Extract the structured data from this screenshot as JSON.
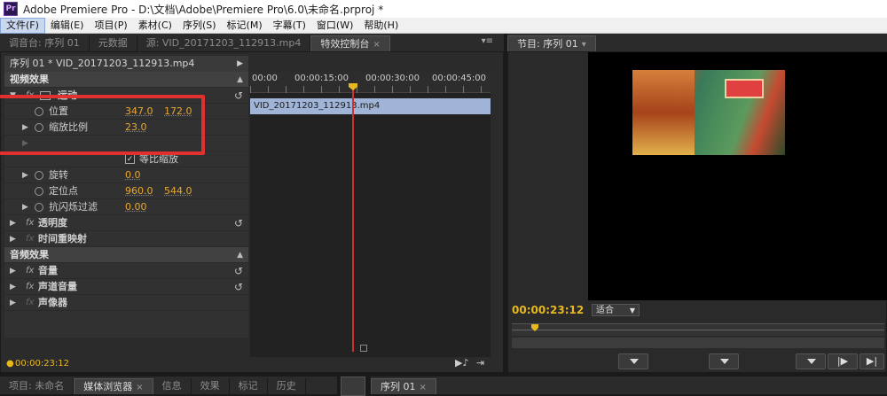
{
  "window": {
    "logo": "Pr",
    "title": "Adobe Premiere Pro - D:\\文档\\Adobe\\Premiere Pro\\6.0\\未命名.prproj *"
  },
  "menu": [
    "文件(F)",
    "编辑(E)",
    "项目(P)",
    "素材(C)",
    "序列(S)",
    "标记(M)",
    "字幕(T)",
    "窗口(W)",
    "帮助(H)"
  ],
  "left_tabs": [
    "调音台: 序列 01",
    "元数据",
    "源: VID_20171203_112913.mp4",
    "特效控制台"
  ],
  "program_tab": "节目: 序列 01",
  "effect_controls": {
    "clip_header": "序列 01 * VID_20171203_112913.mp4",
    "video_effects": "视频效果",
    "motion": "运动",
    "position_label": "位置",
    "position_x": "347.0",
    "position_y": "172.0",
    "scale_label": "缩放比例",
    "scale_value": "23.0",
    "uniform_scale": "等比缩放",
    "rotation_label": "旋转",
    "rotation_value": "0.0",
    "anchor_label": "定位点",
    "anchor_x": "960.0",
    "anchor_y": "544.0",
    "flicker_label": "抗闪烁过滤",
    "flicker_value": "0.00",
    "opacity": "透明度",
    "time_remap": "时间重映射",
    "audio_effects": "音频效果",
    "volume": "音量",
    "channel_volume": "声道音量",
    "panner": "声像器",
    "timecode": "00:00:23:12"
  },
  "timeline": {
    "ruler": [
      "00:00",
      "00:00:15:00",
      "00:00:30:00",
      "00:00:45:00"
    ],
    "clip": "VID_20171203_112913.mp4"
  },
  "program": {
    "timecode": "00:00:23:12",
    "fit": "适合"
  },
  "bottom_tabs": [
    "项目: 未命名",
    "媒体浏览器",
    "信息",
    "效果",
    "标记",
    "历史"
  ],
  "bottom_right_tab": "序列 01",
  "colors": {
    "accent": "#e8a830",
    "highlight": "#e03030",
    "playhead": "#d03030"
  }
}
